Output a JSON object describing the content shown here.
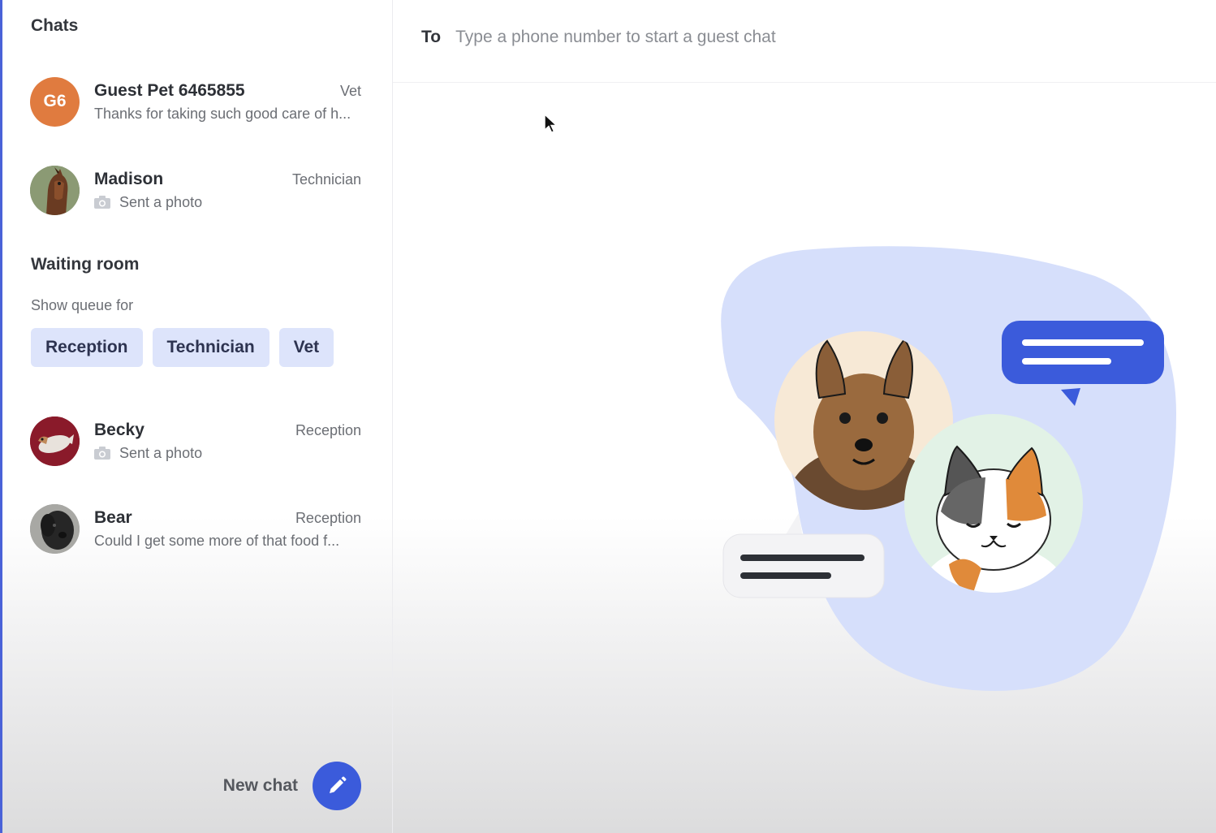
{
  "sidebar": {
    "chats_title": "Chats",
    "chats": [
      {
        "initials": "G6",
        "name": "Guest Pet 6465855",
        "role": "Vet",
        "preview": "Thanks for taking such good care of h...",
        "has_photo": false,
        "avatar_color": "#e07b3f"
      },
      {
        "initials": "",
        "name": "Madison",
        "role": "Technician",
        "preview": "Sent a photo",
        "has_photo": true,
        "avatar_color": "#6b4a33"
      }
    ],
    "waiting_room_title": "Waiting room",
    "queue_label": "Show queue for",
    "queues": [
      "Reception",
      "Technician",
      "Vet"
    ],
    "waiting": [
      {
        "name": "Becky",
        "role": "Reception",
        "preview": "Sent a photo",
        "has_photo": true,
        "avatar_color": "#8a1a2a"
      },
      {
        "name": "Bear",
        "role": "Reception",
        "preview": "Could I get some more of that food f...",
        "has_photo": false,
        "avatar_color": "#3a3a3a"
      }
    ],
    "new_chat_label": "New chat"
  },
  "main": {
    "to_label": "To",
    "to_placeholder": "Type a phone number to start a guest chat"
  },
  "colors": {
    "accent": "#3b5bdb",
    "chip_bg": "#dde4fb",
    "blob": "#d6dffb",
    "guest_avatar": "#e07b3f"
  },
  "icons": {
    "new_chat": "pencil-icon",
    "photo": "camera-icon",
    "pointer": "mouse-cursor-icon"
  }
}
